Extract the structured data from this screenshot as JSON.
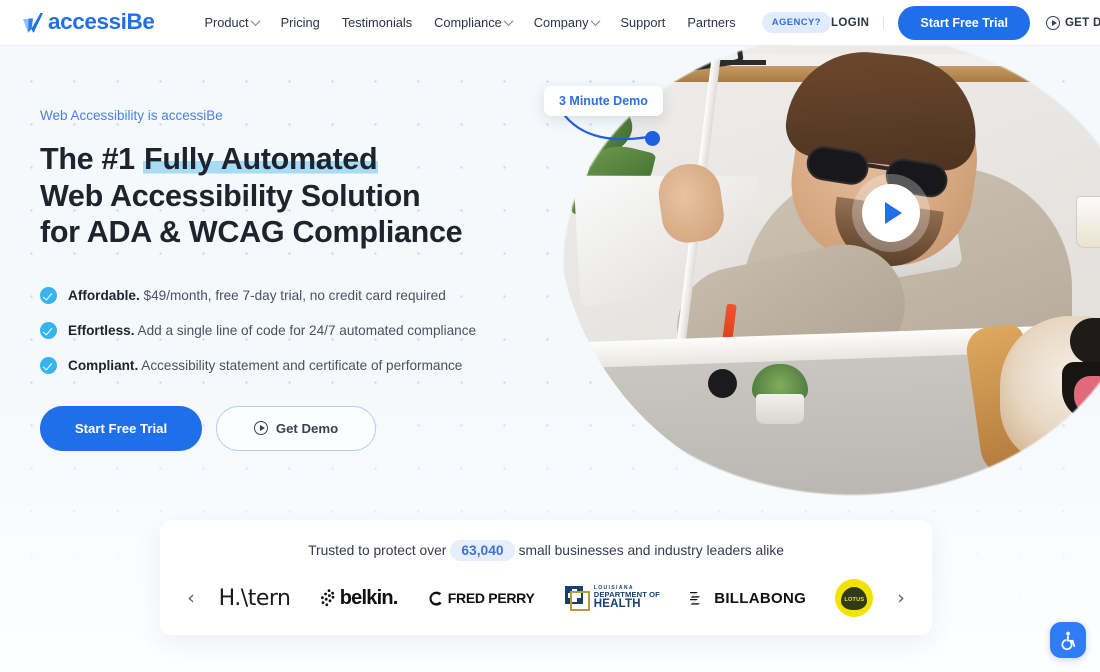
{
  "nav": {
    "logo_text": "accessiBe",
    "logo_icon": "accessibe-checkmark-logo",
    "links": [
      {
        "label": "Product",
        "has_caret": true
      },
      {
        "label": "Pricing",
        "has_caret": false
      },
      {
        "label": "Testimonials",
        "has_caret": false
      },
      {
        "label": "Compliance",
        "has_caret": true
      },
      {
        "label": "Company",
        "has_caret": true
      },
      {
        "label": "Support",
        "has_caret": false
      },
      {
        "label": "Partners",
        "has_caret": false
      }
    ],
    "agency_pill": "AGENCY?",
    "login": "LOGIN",
    "start_free_trial": "Start Free Trial",
    "get_demo": "GET DEMO",
    "get_demo_icon": "play-circle-icon"
  },
  "hero": {
    "eyebrow": "Web Accessibility is accessiBe",
    "headline_line1_pre": "The #1 ",
    "headline_line1_hl": "Fully Automated",
    "headline_line2": "Web Accessibility Solution",
    "headline_line3": "for ADA & WCAG Compliance",
    "bullets": [
      {
        "bold": "Affordable.",
        "text": " $49/month, free 7-day trial, no credit card required"
      },
      {
        "bold": "Effortless.",
        "text": " Add a single line of code for 24/7 automated compliance"
      },
      {
        "bold": "Compliant.",
        "text": " Accessibility statement and certificate of performance"
      }
    ],
    "cta_primary": "Start Free Trial",
    "cta_secondary": "Get Demo",
    "cta_secondary_icon": "play-circle-icon",
    "tooltip": "3 Minute Demo",
    "play_button_icon": "play-triangle-icon",
    "photo_alt": "man-with-sunglasses-white-cane-and-guide-dog-at-desk"
  },
  "trusted": {
    "lead": "Trusted to protect over",
    "count": "63,040",
    "tail": "small businesses and industry leaders alike",
    "prev_icon": "chevron-left-icon",
    "next_icon": "chevron-right-icon",
    "logos": [
      {
        "name": "hstern",
        "text": "H.\\tern"
      },
      {
        "name": "belkin",
        "text": "belkin."
      },
      {
        "name": "fred-perry",
        "text": "FRED PERRY"
      },
      {
        "name": "louisiana-department-of-health",
        "line1": "LOUISIANA",
        "line2": "DEPARTMENT OF",
        "line3": "HEALTH"
      },
      {
        "name": "billabong",
        "text": "BILLABONG"
      },
      {
        "name": "lotus",
        "text": "LOTUS"
      }
    ]
  },
  "a11y": {
    "widget_icon": "wheelchair-accessibility-icon",
    "label": "Accessibility Menu"
  },
  "colors": {
    "brand_blue": "#1f6fe8",
    "accent_cyan": "#35b4ef",
    "highlight": "#a8dcf6",
    "bg": "#f5f9fc",
    "text_dark": "#1e242e"
  }
}
